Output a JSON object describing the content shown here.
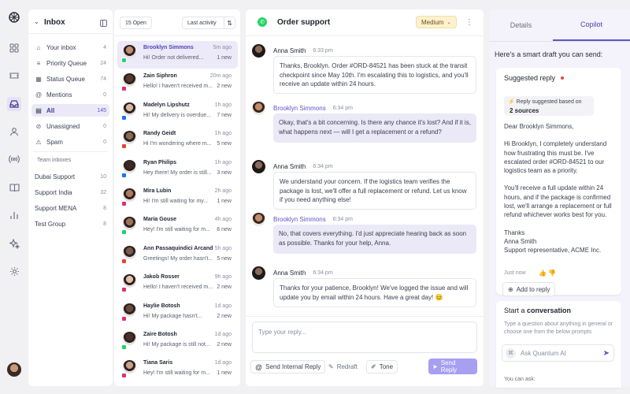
{
  "rail": {
    "icons": [
      "logo-icon",
      "grid-icon",
      "ticket-icon",
      "inbox-icon",
      "user-icon",
      "broadcast-icon",
      "book-icon",
      "chart-icon",
      "sparkle-icon",
      "settings-icon"
    ]
  },
  "inbox": {
    "title": "Inbox",
    "items": [
      {
        "label": "Your inbox",
        "count": "4",
        "icon": "user-inbox-icon"
      },
      {
        "label": "Priority Queue",
        "count": "24",
        "icon": "priority-icon"
      },
      {
        "label": "Status Queue",
        "count": "74",
        "icon": "status-icon"
      },
      {
        "label": "Mentions",
        "count": "0",
        "icon": "mention-icon"
      },
      {
        "label": "All",
        "count": "145",
        "icon": "all-icon"
      },
      {
        "label": "Unassigned",
        "count": "0",
        "icon": "unassigned-icon"
      },
      {
        "label": "Spam",
        "count": "0",
        "icon": "spam-icon"
      }
    ],
    "team_label": "Team inboxes",
    "teams": [
      {
        "label": "Dubai Support",
        "count": "10"
      },
      {
        "label": "Support India",
        "count": "32"
      },
      {
        "label": "Support MENA",
        "count": "8"
      },
      {
        "label": "Test Group",
        "count": "8"
      }
    ]
  },
  "list": {
    "open_label": "15 Open",
    "sort_label": "Last activity",
    "items": [
      {
        "name": "Brooklyn Simmons",
        "preview": "Hi! Order not delivered...",
        "time": "5m ago",
        "new": "1 new",
        "channel": "whatsapp"
      },
      {
        "name": "Zain Siphron",
        "preview": "Hello! I haven't received m...",
        "time": "20m ago",
        "new": "2 new",
        "channel": "instagram"
      },
      {
        "name": "Madelyn Lipshutz",
        "preview": "Hi! My delivery is overdue...",
        "time": "1h ago",
        "new": "7 new",
        "channel": "facebook"
      },
      {
        "name": "Randy Geidt",
        "preview": "Hi I'm wondering where m...",
        "time": "1h ago",
        "new": "5 new",
        "channel": "gmail"
      },
      {
        "name": "Ryan Philips",
        "preview": "Hey there! My order is still...",
        "time": "1h ago",
        "new": "3 new",
        "channel": "facebook"
      },
      {
        "name": "Mira Lubin",
        "preview": "Hi! I'm still waiting for my...",
        "time": "2h ago",
        "new": "1 new",
        "channel": "instagram"
      },
      {
        "name": "Maria Gouse",
        "preview": "Hey! I'm still waiting for m...",
        "time": "4h ago",
        "new": "6 new",
        "channel": "whatsapp"
      },
      {
        "name": "Ann Passaquindici Arcand",
        "preview": "Greetings! My order hasn't...",
        "time": "5h ago",
        "new": "5 new",
        "channel": "gmail"
      },
      {
        "name": "Jakob Rosser",
        "preview": "Hello! I haven't received m...",
        "time": "9h ago",
        "new": "2 new",
        "channel": "instagram"
      },
      {
        "name": "Haylie Botosh",
        "preview": "Hi! My package hasn't...",
        "time": "1d ago",
        "new": "2 new",
        "channel": "instagram"
      },
      {
        "name": "Zaire Botosh",
        "preview": "Hi! My package is still not...",
        "time": "1d ago",
        "new": "2 new",
        "channel": "whatsapp"
      },
      {
        "name": "Tiana Saris",
        "preview": "Hey! I'm still waiting for m...",
        "time": "1d ago",
        "new": "1 new",
        "channel": "instagram"
      }
    ]
  },
  "chat": {
    "title": "Order support",
    "priority": "Medium",
    "messages": [
      {
        "author": "Anna Smith",
        "time": "6:33 pm",
        "role": "agent",
        "text": "Thanks, Brooklyn. Order #ORD-84521 has been stuck at the transit checkpoint since May 10th. I'm escalating this to logistics, and you'll receive an update within 24 hours."
      },
      {
        "author": "Brooklyn Simmons",
        "time": "6:34 pm",
        "role": "customer",
        "text": "Okay, that's a bit concerning. Is there any chance it's lost? And if it is, what happens next — will I get a replacement or a refund?"
      },
      {
        "author": "Anna Smith",
        "time": "6:34 pm",
        "role": "agent",
        "text": "We understand your concern. If the logistics team verifies the package is lost, we'll offer a full replacement or refund. Let us know if you need anything else!"
      },
      {
        "author": "Brooklyn Simmons",
        "time": "6:34 pm",
        "role": "customer",
        "text": "No, that covers everything. I'd just appreciate hearing back as soon as possible. Thanks for your help, Anna."
      },
      {
        "author": "Anna Smith",
        "time": "6:34 pm",
        "role": "agent",
        "text": "Thanks for your patience, Brooklyn! We've logged the issue and will update you by email within 24 hours. Have a great day! 😊"
      }
    ],
    "reply_placeholder": "Type your reply...",
    "send_internal": "Send Internal Reply",
    "redraft": "Redraft",
    "tone": "Tone",
    "send_reply": "Send Reply"
  },
  "copilot": {
    "tab_details": "Details",
    "tab_copilot": "Copilot",
    "intro": "Here's a smart draft you can send:",
    "suggested_title": "Suggested reply",
    "sources_line": "Reply suggested based on",
    "sources_count": "2 sources",
    "draft_greeting": "Dear Brooklyn Simmons,",
    "draft_p1": "Hi Brooklyn, I completely understand how frustrating this must be. I've escalated order #ORD-84521 to our logistics team as a priority.",
    "draft_p2": "You'll receive a full update within 24 hours, and if the package is confirmed lost, we'll arrange a replacement or full refund whichever works best for you.",
    "draft_sign1": "Thanks",
    "draft_sign2": "Anna Smith",
    "draft_sign3": "Support representative, ACME Inc.",
    "draft_time": "Just now",
    "add_to_reply": "Add to reply",
    "start_prefix": "Start a",
    "start_bold": "conversation",
    "start_hint": "Type a question about anything in general or choose one from the below prompts",
    "ask_placeholder": "Ask Quantum AI",
    "you_can_ask": "You can ask:"
  },
  "colors": {
    "accent": "#5b57c8",
    "send": "#a79ff0",
    "whatsapp": "#25d366",
    "priority_bg": "#fdf1cf"
  }
}
